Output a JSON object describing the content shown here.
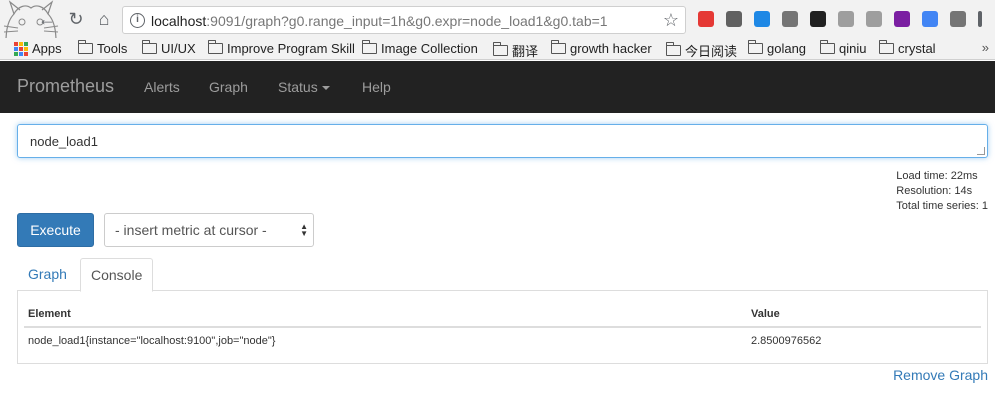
{
  "browser": {
    "url_host": "localhost",
    "url_rest": ":9091/graph?g0.range_input=1h&g0.expr=node_load1&g0.tab=1",
    "nav": {
      "back": "←",
      "reload": "↻",
      "home": "⌂"
    },
    "star": "☆",
    "extensions": [
      {
        "name": "opera-extension-icon",
        "color": "#e53935"
      },
      {
        "name": "settings-extension-icon",
        "color": "#616161"
      },
      {
        "name": "a-extension-icon",
        "color": "#1e88e5"
      },
      {
        "name": "circle-extension-icon",
        "color": "#757575"
      },
      {
        "name": "qr-extension-icon",
        "color": "#212121"
      },
      {
        "name": "page-extension-icon",
        "color": "#9e9e9e"
      },
      {
        "name": "tab-extension-icon",
        "color": "#9e9e9e"
      },
      {
        "name": "onenote-extension-icon",
        "color": "#7b1fa2"
      },
      {
        "name": "translate-extension-icon",
        "color": "#4285f4"
      },
      {
        "name": "camera-extension-icon",
        "color": "#757575"
      },
      {
        "name": "menu-icon",
        "color": "#5f6368"
      }
    ]
  },
  "bookmarks": {
    "apps": "Apps",
    "items": [
      "Tools",
      "UI/UX",
      "Improve Program Skill",
      "Image Collection",
      "翻译",
      "growth hacker",
      "今日阅读",
      "golang",
      "qiniu",
      "crystal"
    ],
    "more": "»"
  },
  "navbar": {
    "brand": "Prometheus",
    "alerts": "Alerts",
    "graph": "Graph",
    "status": "Status",
    "help": "Help"
  },
  "query": {
    "expression": "node_load1",
    "load_time": "Load time: 22ms",
    "resolution": "Resolution: 14s",
    "total_series": "Total time series: 1"
  },
  "controls": {
    "execute": "Execute",
    "metric_select": "- insert metric at cursor -"
  },
  "tabs": {
    "graph": "Graph",
    "console": "Console"
  },
  "table": {
    "col_element": "Element",
    "col_value": "Value",
    "row_element": "node_load1{instance=\"localhost:9100\",job=\"node\"}",
    "row_value": "2.8500976562"
  },
  "remove_graph": "Remove Graph",
  "colors": {
    "navbar_bg": "#222222",
    "link": "#337ab7",
    "execute_bg": "#337ab7"
  }
}
